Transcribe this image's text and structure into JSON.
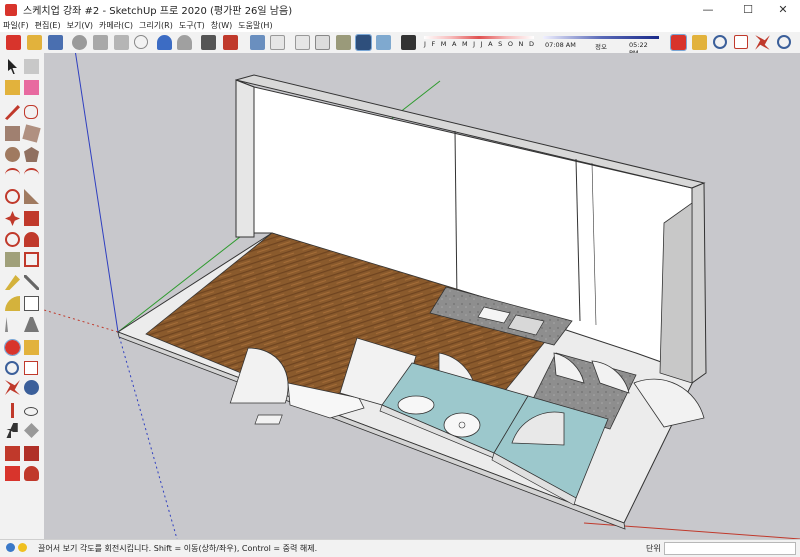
{
  "window": {
    "title": "스케치업 강좌 #2 - SketchUp 프로 2020 (평가판 26일 남음)",
    "minimize_glyph": "—",
    "maximize_glyph": "☐",
    "close_glyph": "✕"
  },
  "menu": [
    "파일(F)",
    "편집(E)",
    "보기(V)",
    "카메라(C)",
    "그리기(R)",
    "도구(T)",
    "창(W)",
    "도움말(H)"
  ],
  "shadow": {
    "months": [
      "J",
      "F",
      "M",
      "A",
      "M",
      "J",
      "J",
      "A",
      "S",
      "O",
      "N",
      "D"
    ],
    "time_start": "07:08 AM",
    "noon_label": "정오",
    "time_end": "05:22 PM"
  },
  "statusbar": {
    "message": "끌어서 보기 각도를 회전시킵니다. Shift = 이동(상하/좌우), Control = 중력 해제.",
    "measurement_label": "단위",
    "measurement_value": ""
  },
  "colors": {
    "wood": "#8a5a2c",
    "bathroom_floor": "#9cc8cc",
    "stone": "#8e8e8e",
    "wall": "#ffffff",
    "background": "#c8c8cc",
    "axis_green": "#2e9b2e",
    "axis_red": "#c0392b",
    "axis_blue": "#2f3fc0"
  },
  "icons": {
    "top_toolbar": [
      "new-file",
      "open-file",
      "save",
      "cut",
      "copy",
      "paste",
      "erase",
      "undo",
      "redo",
      "print",
      "model-info",
      "iso-view",
      "top-view",
      "front-view",
      "right-view",
      "back-view",
      "left-view",
      "hidden-line",
      "shaded-textures",
      "x-ray",
      "shadows",
      "orbit",
      "pan",
      "zoom",
      "zoom-window",
      "zoom-extents",
      "previous-view"
    ],
    "left_toolbar": [
      "select",
      "make-component",
      "paint-bucket",
      "eraser",
      "line",
      "freehand",
      "rectangle",
      "rotated-rectangle",
      "circle",
      "polygon",
      "arc",
      "two-point-arc",
      "three-point-arc",
      "pie",
      "move",
      "push-pull",
      "rotate",
      "follow-me",
      "scale",
      "offset",
      "tape-measure",
      "dimension",
      "protractor",
      "text",
      "axes",
      "3d-text",
      "orbit",
      "pan",
      "zoom",
      "zoom-window",
      "zoom-extents",
      "previous",
      "position-camera",
      "look-around",
      "walk",
      "section-plane",
      "warehouse",
      "extension-warehouse"
    ]
  }
}
